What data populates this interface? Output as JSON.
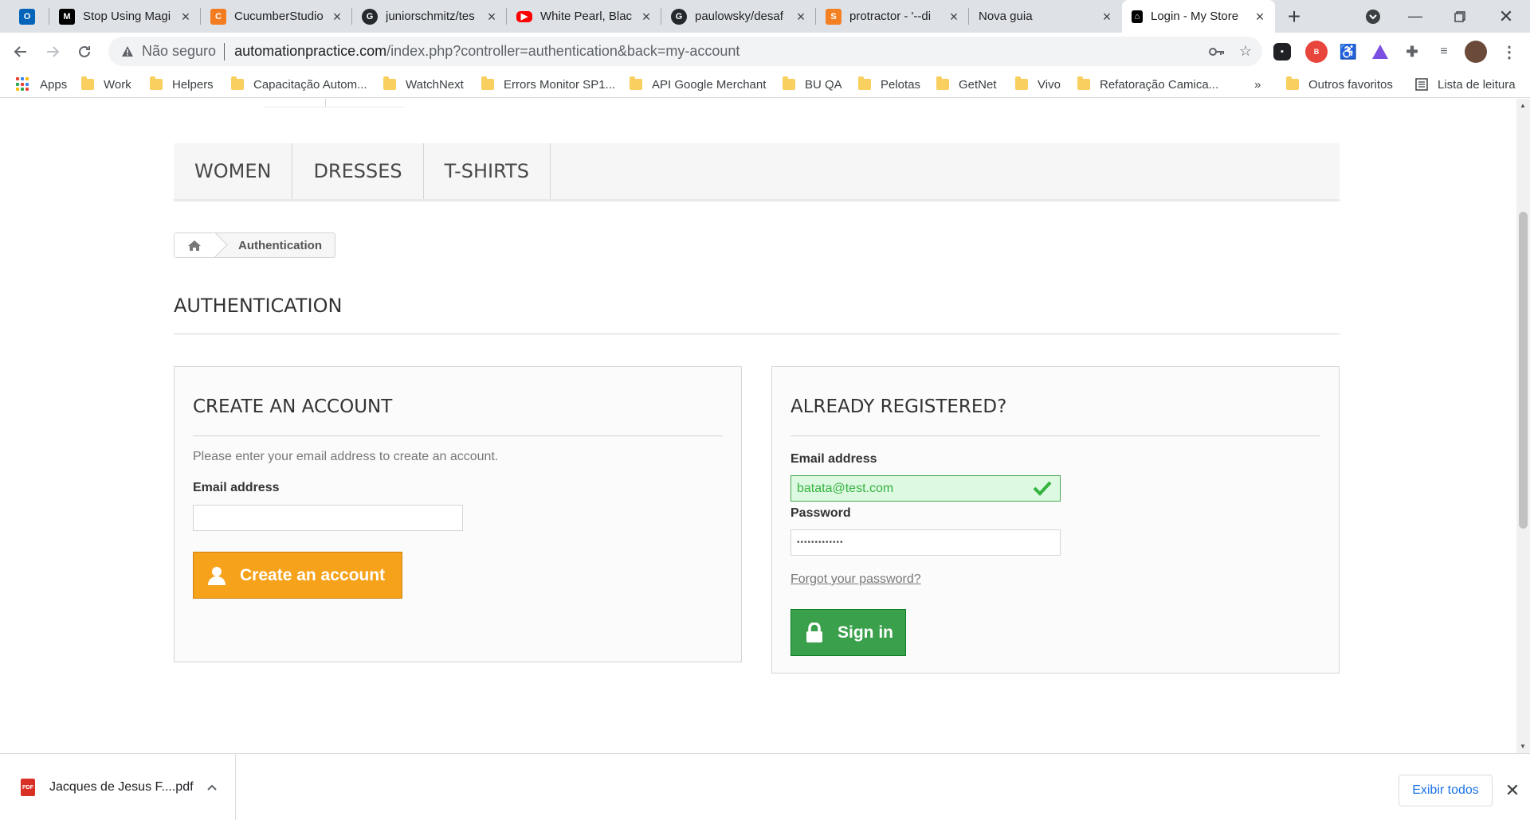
{
  "tabs": [
    {
      "title": "",
      "favicon": "outlook-icon",
      "color": "#0364b8"
    },
    {
      "title": "Stop Using Magi",
      "favicon": "medium-icon",
      "color": "#000000"
    },
    {
      "title": "CucumberStudio",
      "favicon": "cucumberstudio-icon",
      "color": "#f47c20"
    },
    {
      "title": "juniorschmitz/tes",
      "favicon": "github-icon",
      "color": "#24292e"
    },
    {
      "title": "White Pearl, Blac",
      "favicon": "youtube-icon",
      "color": "#ff0000"
    },
    {
      "title": "paulowsky/desaf",
      "favicon": "github-icon",
      "color": "#24292e"
    },
    {
      "title": "protractor - '--di",
      "favicon": "stackoverflow-icon",
      "color": "#f48024"
    },
    {
      "title": "Nova guia",
      "favicon": "",
      "color": ""
    },
    {
      "title": "Login - My Store",
      "favicon": "mystore-icon",
      "color": "#000000",
      "active": true
    }
  ],
  "address_bar": {
    "security_label": "Não seguro",
    "url_domain": "automationpractice.com",
    "url_path": "/index.php?controller=authentication&back=my-account"
  },
  "bookmarks": {
    "apps_label": "Apps",
    "items": [
      "Work",
      "Helpers",
      "Capacitação Autom...",
      "WatchNext",
      "Errors Monitor SP1...",
      "API Google Merchant",
      "BU QA",
      "Pelotas",
      "GetNet",
      "Vivo",
      "Refatoração Camica..."
    ],
    "overflow": "»",
    "other_favorites": "Outros favoritos",
    "reading_list": "Lista de leitura"
  },
  "store": {
    "menu": [
      "Women",
      "Dresses",
      "T-shirts"
    ],
    "breadcrumb": "Authentication",
    "page_heading": "Authentication",
    "create_account": {
      "heading": "CREATE AN ACCOUNT",
      "hint": "Please enter your email address to create an account.",
      "email_label": "Email address",
      "email_value": "",
      "button_label": "Create an account"
    },
    "login": {
      "heading": "ALREADY REGISTERED?",
      "email_label": "Email address",
      "email_value": "batata@test.com",
      "password_label": "Password",
      "password_value": "•••••••••••••",
      "forgot_label": "Forgot your password?",
      "button_label": "Sign in"
    }
  },
  "downloads": {
    "file_name": "Jacques de Jesus F....pdf",
    "show_all_label": "Exibir todos"
  },
  "colors": {
    "orange_button": "#f7a21b",
    "green_button": "#3aa04c",
    "valid_field": "#ddf9e1"
  }
}
